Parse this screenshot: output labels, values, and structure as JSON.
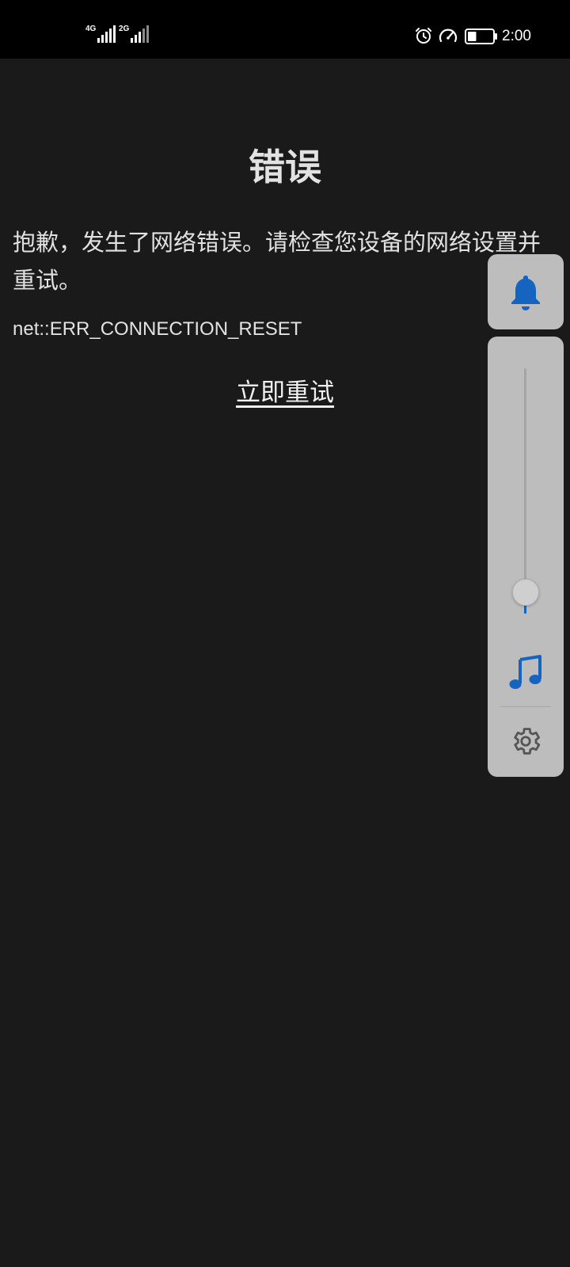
{
  "status_bar": {
    "sim1_network": "4G",
    "sim2_network": "2G",
    "time": "2:00",
    "battery_level": 0.35,
    "icons": [
      "alarm-icon",
      "speedometer-icon",
      "battery-icon"
    ]
  },
  "error_page": {
    "title": "错误",
    "message": "抱歉，发生了网络错误。请检查您设备的网络设置并重试。",
    "error_code": "net::ERR_CONNECTION_RESET",
    "retry_label": "立即重试"
  },
  "volume_panel": {
    "ringer_icon": "bell-icon",
    "stream_icon": "music-note-icon",
    "settings_icon": "gear-icon",
    "volume_level": 0.05,
    "accent_color": "#1565c0",
    "panel_color": "#bdbdbd"
  },
  "colors": {
    "background": "#1a1a1a",
    "text": "#e2e2e2",
    "status_bar": "#000000"
  }
}
